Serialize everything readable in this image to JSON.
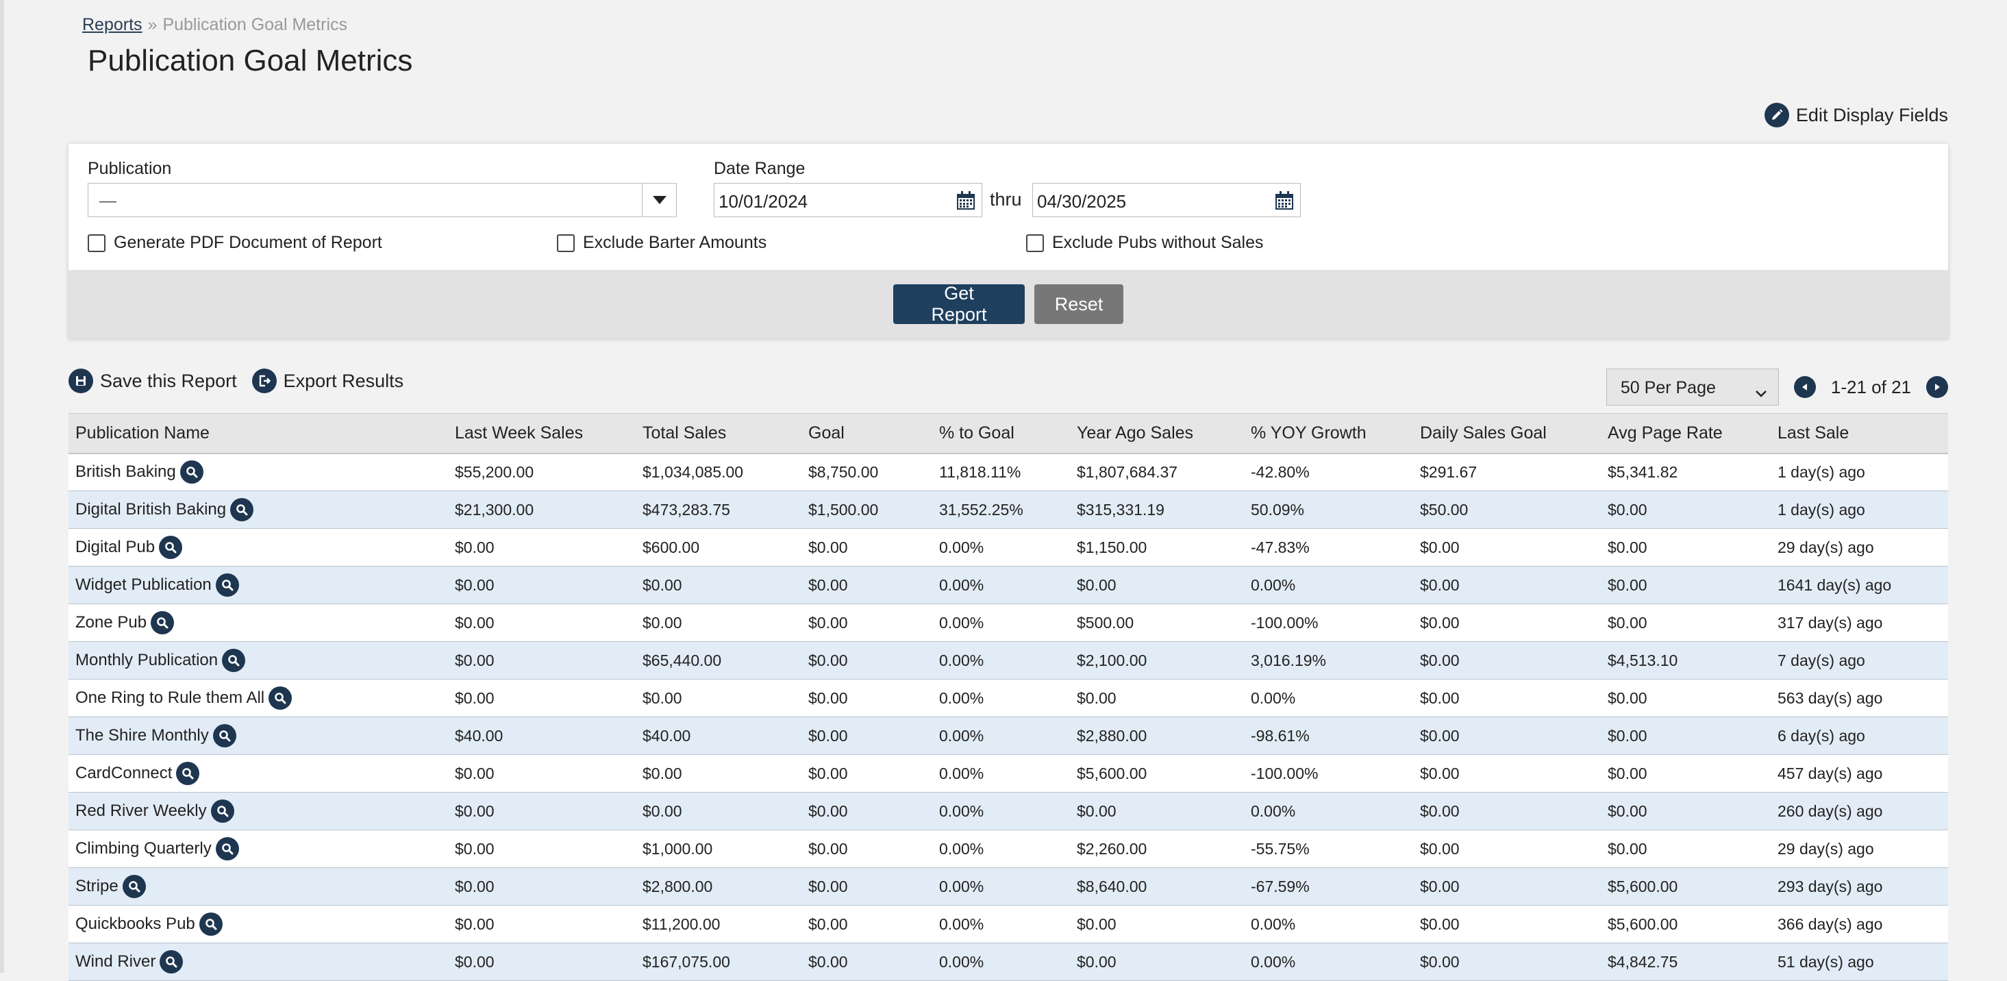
{
  "breadcrumb": {
    "root": "Reports",
    "separator": "»",
    "current": "Publication Goal Metrics"
  },
  "page": {
    "title": "Publication Goal Metrics",
    "edit_fields_label": "Edit Display Fields"
  },
  "filters": {
    "publication_label": "Publication",
    "publication_value": "—",
    "date_range_label": "Date Range",
    "date_from": "10/01/2024",
    "thru_label": "thru",
    "date_to": "04/30/2025",
    "checkboxes": [
      {
        "label": "Generate PDF Document of Report",
        "checked": false
      },
      {
        "label": "Exclude Barter Amounts",
        "checked": false
      },
      {
        "label": "Exclude Pubs without Sales",
        "checked": false
      }
    ],
    "get_report_label": "Get Report",
    "reset_label": "Reset"
  },
  "actions": {
    "save_label": "Save this Report",
    "export_label": "Export Results"
  },
  "pager": {
    "per_page": "50 Per Page",
    "range": "1-21 of 21"
  },
  "table": {
    "headers": [
      "Publication Name",
      "Last Week Sales",
      "Total Sales",
      "Goal",
      "% to Goal",
      "Year Ago Sales",
      "% YOY Growth",
      "Daily Sales Goal",
      "Avg Page Rate",
      "Last Sale"
    ],
    "rows": [
      [
        "British Baking",
        "$55,200.00",
        "$1,034,085.00",
        "$8,750.00",
        "11,818.11%",
        "$1,807,684.37",
        "-42.80%",
        "$291.67",
        "$5,341.82",
        "1 day(s) ago"
      ],
      [
        "Digital British Baking",
        "$21,300.00",
        "$473,283.75",
        "$1,500.00",
        "31,552.25%",
        "$315,331.19",
        "50.09%",
        "$50.00",
        "$0.00",
        "1 day(s) ago"
      ],
      [
        "Digital Pub",
        "$0.00",
        "$600.00",
        "$0.00",
        "0.00%",
        "$1,150.00",
        "-47.83%",
        "$0.00",
        "$0.00",
        "29 day(s) ago"
      ],
      [
        "Widget Publication",
        "$0.00",
        "$0.00",
        "$0.00",
        "0.00%",
        "$0.00",
        "0.00%",
        "$0.00",
        "$0.00",
        "1641 day(s) ago"
      ],
      [
        "Zone Pub",
        "$0.00",
        "$0.00",
        "$0.00",
        "0.00%",
        "$500.00",
        "-100.00%",
        "$0.00",
        "$0.00",
        "317 day(s) ago"
      ],
      [
        "Monthly Publication",
        "$0.00",
        "$65,440.00",
        "$0.00",
        "0.00%",
        "$2,100.00",
        "3,016.19%",
        "$0.00",
        "$4,513.10",
        "7 day(s) ago"
      ],
      [
        "One Ring to Rule them All",
        "$0.00",
        "$0.00",
        "$0.00",
        "0.00%",
        "$0.00",
        "0.00%",
        "$0.00",
        "$0.00",
        "563 day(s) ago"
      ],
      [
        "The Shire Monthly",
        "$40.00",
        "$40.00",
        "$0.00",
        "0.00%",
        "$2,880.00",
        "-98.61%",
        "$0.00",
        "$0.00",
        "6 day(s) ago"
      ],
      [
        "CardConnect",
        "$0.00",
        "$0.00",
        "$0.00",
        "0.00%",
        "$5,600.00",
        "-100.00%",
        "$0.00",
        "$0.00",
        "457 day(s) ago"
      ],
      [
        "Red River Weekly",
        "$0.00",
        "$0.00",
        "$0.00",
        "0.00%",
        "$0.00",
        "0.00%",
        "$0.00",
        "$0.00",
        "260 day(s) ago"
      ],
      [
        "Climbing Quarterly",
        "$0.00",
        "$1,000.00",
        "$0.00",
        "0.00%",
        "$2,260.00",
        "-55.75%",
        "$0.00",
        "$0.00",
        "29 day(s) ago"
      ],
      [
        "Stripe",
        "$0.00",
        "$2,800.00",
        "$0.00",
        "0.00%",
        "$8,640.00",
        "-67.59%",
        "$0.00",
        "$5,600.00",
        "293 day(s) ago"
      ],
      [
        "Quickbooks Pub",
        "$0.00",
        "$11,200.00",
        "$0.00",
        "0.00%",
        "$0.00",
        "0.00%",
        "$0.00",
        "$5,600.00",
        "366 day(s) ago"
      ],
      [
        "Wind River",
        "$0.00",
        "$167,075.00",
        "$0.00",
        "0.00%",
        "$0.00",
        "0.00%",
        "$0.00",
        "$4,842.75",
        "51 day(s) ago"
      ]
    ]
  },
  "colors": {
    "primary": "#1e3f5e",
    "icon": "#1e3650",
    "row_alt": "#e2ecf6",
    "reset": "#777777"
  }
}
